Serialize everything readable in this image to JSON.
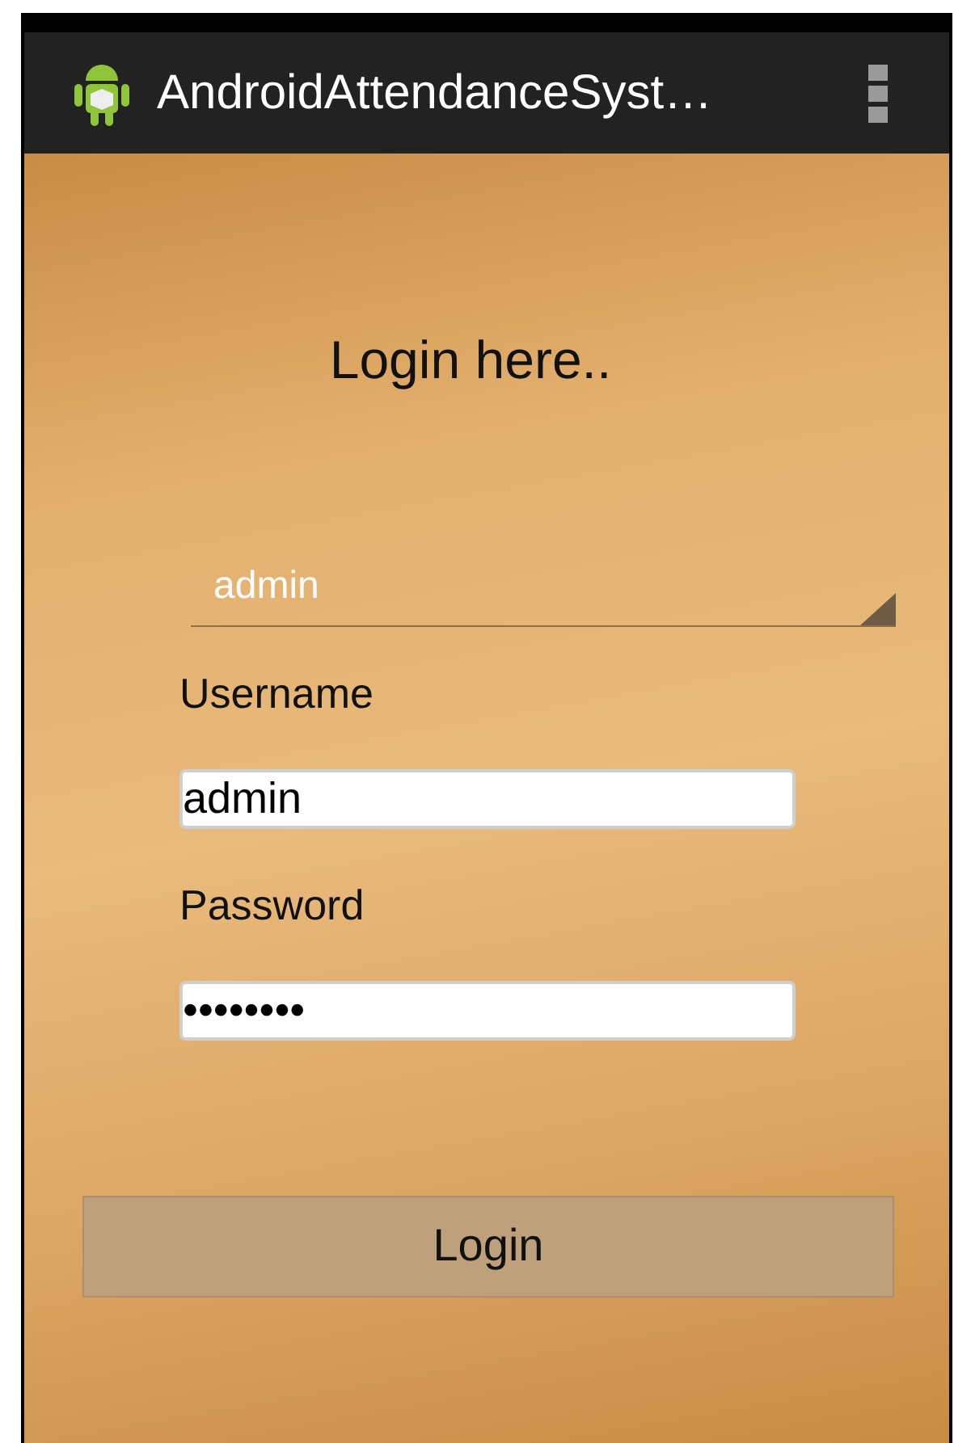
{
  "action_bar": {
    "title": "AndroidAttendanceSyst…"
  },
  "heading": "Login here..",
  "role_spinner": {
    "value": "admin"
  },
  "fields": [
    {
      "label": "Username",
      "value": "admin"
    },
    {
      "label": "Password",
      "value": "••••••••"
    }
  ],
  "login_button": "Login"
}
